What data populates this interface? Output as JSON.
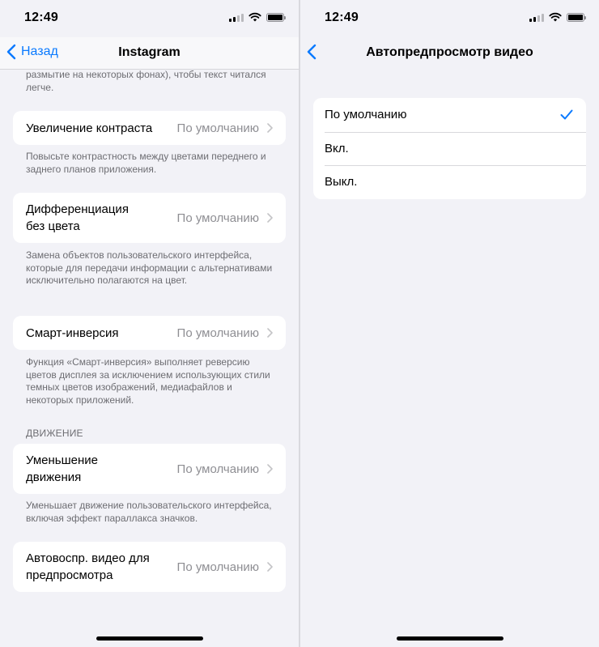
{
  "left": {
    "status": {
      "time": "12:49"
    },
    "nav": {
      "back_label": "Назад",
      "title": "Instagram"
    },
    "top_note": "размытие на некоторых фонах), чтобы текст читался легче.",
    "contrast": {
      "label": "Увеличение контраста",
      "value": "По умолчанию",
      "note": "Повысьте контрастность между цветами переднего и заднего планов приложения."
    },
    "differentiate": {
      "label": "Дифференциация без цвета",
      "value": "По умолчанию",
      "note": "Замена объектов пользовательского интерфейса, которые для передачи информации с альтернативами исключительно полагаются на цвет."
    },
    "smart_invert": {
      "label": "Смарт-инверсия",
      "value": "По умолчанию",
      "note": "Функция «Смарт-инверсия» выполняет реверсию цветов дисплея за исключением использующих стили темных цветов изображений, медиафайлов и некоторых приложений."
    },
    "motion_header": "ДВИЖЕНИЕ",
    "reduce_motion": {
      "label": "Уменьшение движения",
      "value": "По умолчанию",
      "note": "Уменьшает движение пользовательского интерфейса, включая эффект параллакса значков."
    },
    "video_autoplay": {
      "label": "Автовоспр. видео для предпросмотра",
      "value": "По умолчанию"
    }
  },
  "right": {
    "status": {
      "time": "12:49"
    },
    "nav": {
      "title": "Автопредпросмотр видео"
    },
    "options": [
      {
        "label": "По умолчанию",
        "selected": true
      },
      {
        "label": "Вкл.",
        "selected": false
      },
      {
        "label": "Выкл.",
        "selected": false
      }
    ]
  },
  "colors": {
    "accent": "#0a7aff",
    "background": "#f2f2f7",
    "secondary_text": "#8e8e93",
    "footnote_text": "#6d6d72"
  },
  "icons": [
    "back-chevron-icon",
    "chevron-right-icon",
    "checkmark-icon",
    "wifi-icon",
    "cellular-signal-icon",
    "battery-icon"
  ]
}
